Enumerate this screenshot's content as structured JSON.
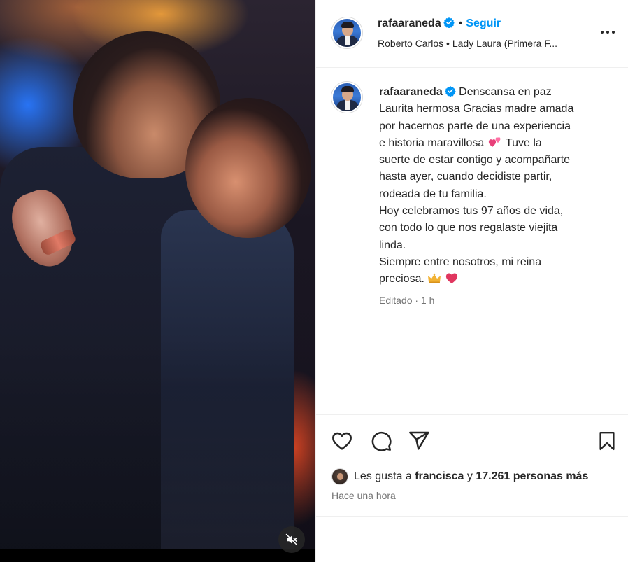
{
  "post": {
    "username": "rafaaraneda",
    "follow_label": "Seguir",
    "separator": "•",
    "audio": "Roberto Carlos • Lady Laura (Primera F...",
    "caption_lines": [
      "Denscansa en paz",
      "Laurita hermosa Gracias madre amada",
      "por hacernos parte de una experiencia",
      "e historia maravillosa",
      "Tuve la",
      "suerte de estar contigo y acompañarte",
      "hasta ayer, cuando decidiste partir,",
      "rodeada de tu familia.",
      "Hoy celebramos tus 97 años de vida,",
      "con todo lo que nos regalaste viejita",
      "linda.",
      "Siempre entre nosotros, mi reina",
      "preciosa."
    ],
    "edited_label": "Editado · 1 h",
    "likes_prefix": "Les gusta a",
    "likes_user": "francisca",
    "likes_conj": "y",
    "likes_count": "17.261 personas más",
    "posted_ago": "Hace una hora"
  },
  "icons": {
    "verified": "verified-badge-icon",
    "more": "more-options-icon",
    "like": "heart-icon",
    "comment": "comment-icon",
    "share": "share-icon",
    "save": "bookmark-icon",
    "mute": "muted-speaker-icon"
  },
  "colors": {
    "accent": "#0095f6",
    "verified": "#0095f6",
    "text": "#262626",
    "secondary": "#737373"
  }
}
